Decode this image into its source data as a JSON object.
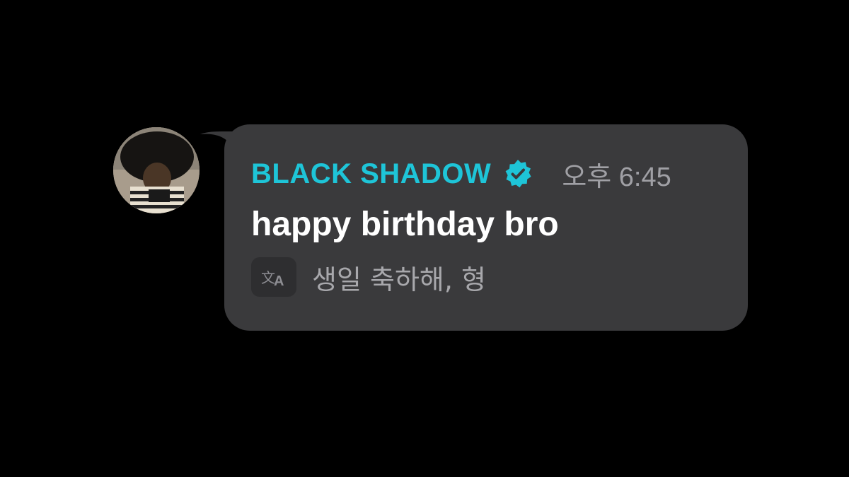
{
  "message": {
    "sender_name": "BLACK SHADOW",
    "verified_icon": "verified-badge-icon",
    "timestamp": "오후 6:45",
    "text": "happy birthday bro",
    "translation": "생일 축하해, 형",
    "translate_icon": "translate-icon"
  },
  "colors": {
    "background": "#000000",
    "bubble": "#3a3a3c",
    "sender_name": "#1ec5d8",
    "message_text": "#ffffff",
    "secondary_text": "#a0a0a5"
  }
}
